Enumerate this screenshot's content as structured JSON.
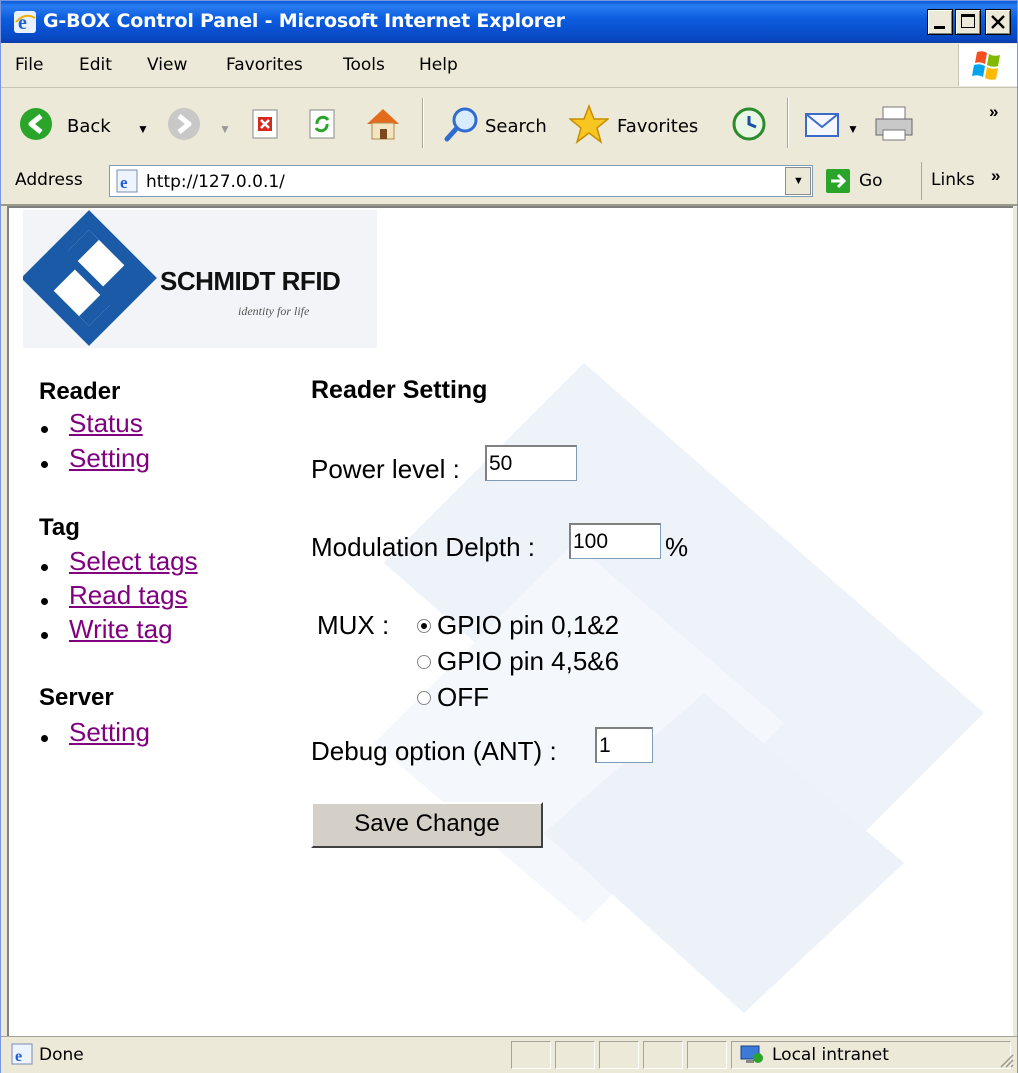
{
  "window": {
    "title": "G-BOX Control Panel - Microsoft Internet Explorer"
  },
  "menu": [
    "File",
    "Edit",
    "View",
    "Favorites",
    "Tools",
    "Help"
  ],
  "toolbar": {
    "back_label": "Back",
    "search_label": "Search",
    "favorites_label": "Favorites",
    "more": "»"
  },
  "address": {
    "label": "Address",
    "url": "http://127.0.0.1/",
    "go_label": "Go",
    "links_label": "Links",
    "links_more": "»"
  },
  "logo": {
    "name": "SCHMIDT RFID",
    "tagline": "identity for life",
    "colors": {
      "blue": "#1b5aa6"
    }
  },
  "nav": {
    "reader_heading": "Reader",
    "reader_items": [
      "Status",
      "Setting"
    ],
    "tag_heading": "Tag",
    "tag_items": [
      "Select tags",
      "Read tags",
      "Write tag"
    ],
    "server_heading": "Server",
    "server_items": [
      "Setting"
    ]
  },
  "form": {
    "heading": "Reader Setting",
    "power_label": "Power level :",
    "power_value": "50",
    "modulation_label": "Modulation Delpth :",
    "modulation_value": "100",
    "modulation_unit": "%",
    "mux_label": "MUX :",
    "mux_options": [
      "GPIO pin 0,1&2",
      "GPIO pin 4,5&6",
      "OFF"
    ],
    "mux_selected": "GPIO pin 0,1&2",
    "debug_label": "Debug option (ANT) :",
    "debug_value": "1",
    "save_label": "Save Change"
  },
  "status": {
    "text": "Done",
    "zone": "Local intranet"
  }
}
